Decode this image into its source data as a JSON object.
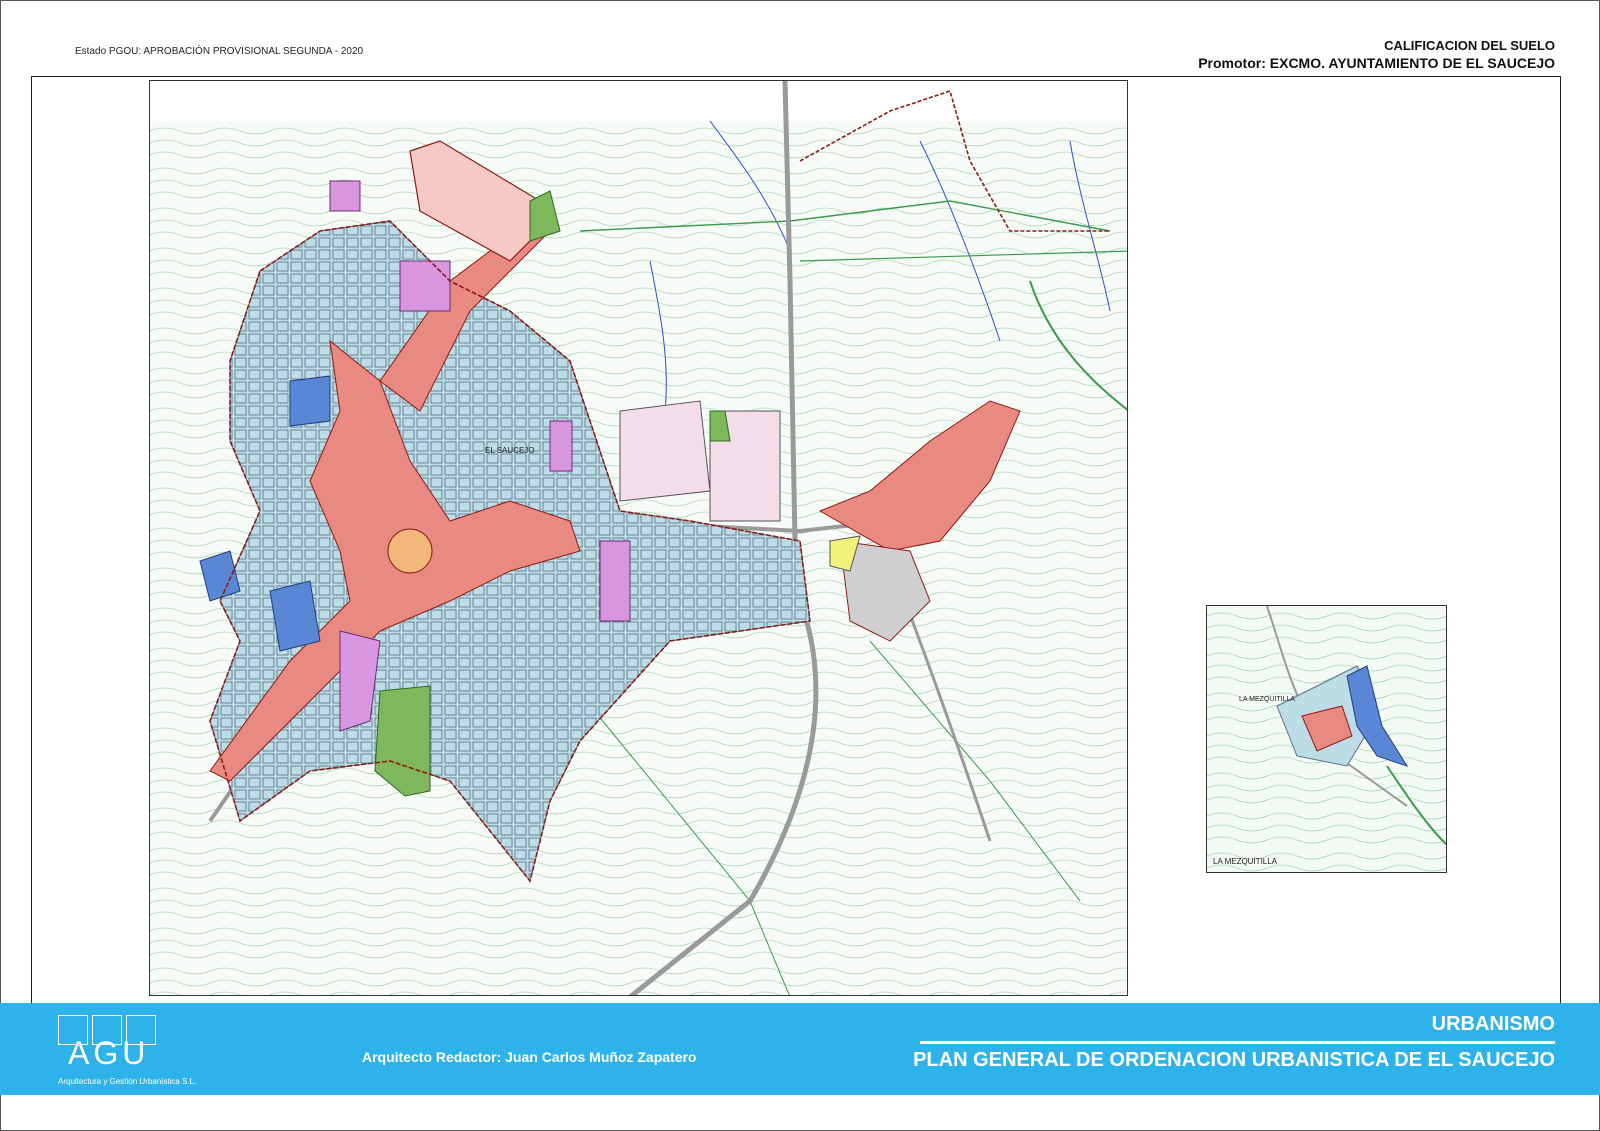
{
  "header": {
    "status": "Estado PGOU: APROBACIÓN PROVISIONAL SEGUNDA - 2020",
    "sheet_title": "CALIFICACION DEL SUELO",
    "promoter": "Promotor: EXCMO. AYUNTAMIENTO DE EL SAUCEJO"
  },
  "map": {
    "town_label": "EL SAUCEJO",
    "inset_village_label": "LA MEZQUITILLA",
    "inset_caption": "LA MEZQUITILLA"
  },
  "footer": {
    "logo_text": "AGU",
    "logo_subtitle": "Arquitectura y Gestión Urbanística S.L.",
    "architect": "Arquitecto Redactor: Juan Carlos Muñoz Zapatero",
    "department": "URBANISMO",
    "plan_title": "PLAN GENERAL DE ORDENACION URBANISTICA DE EL SAUCEJO"
  },
  "colors": {
    "footer_bg": "#2db3ea",
    "residential_centre": "#e98a82",
    "residential": "#bcdce8",
    "equipment": "#d896e0",
    "industrial": "#f4dce8",
    "green_space": "#7fb75c",
    "dense_residential": "#5a86d6",
    "contour_lines": "#55a86a",
    "boundary": "#8e1a12"
  }
}
